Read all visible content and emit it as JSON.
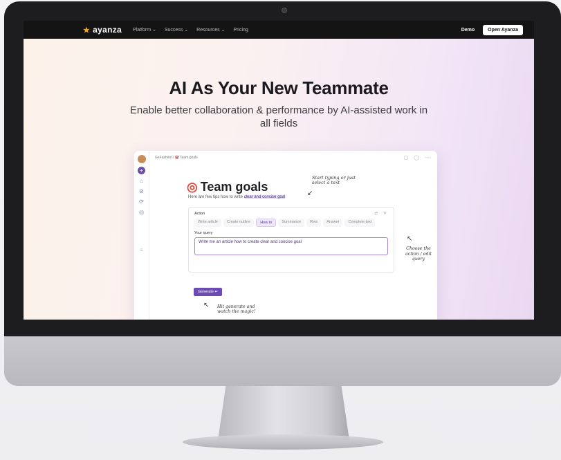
{
  "nav": {
    "logo_text": "ayanza",
    "links": [
      "Platform ⌄",
      "Success ⌄",
      "Resources ⌄",
      "Pricing"
    ],
    "demo": "Demo",
    "open_button": "Open Ayanza"
  },
  "hero": {
    "title": "AI As Your New Teammate",
    "subtitle": "Enable better collaboration & performance by AI-assisted work in all fields"
  },
  "app": {
    "breadcrumb": "GeFashion  /  🎯 Team goals",
    "doc_title": "Team goals",
    "tips_prefix": "Here are few tips how to write ",
    "tips_highlight": "clear and concise goal",
    "action_label": "Action",
    "chips": [
      "Write article",
      "Create outline",
      "How to",
      "Summarize",
      "Rew",
      "Answer",
      "Complete text"
    ],
    "active_chip": "How to",
    "query_label": "Your query",
    "query_value": "Write me an article how to create clear and concise goal",
    "generate_button": "Generate ↵",
    "note_top": "Start typing or just select a text",
    "note_right": "Choose the action / edit query",
    "note_bottom": "Hit generate and watch the magic!"
  },
  "colors": {
    "accent": "#6c4cb2",
    "logo_star": "#f5a623",
    "nav_bg": "#141414"
  }
}
